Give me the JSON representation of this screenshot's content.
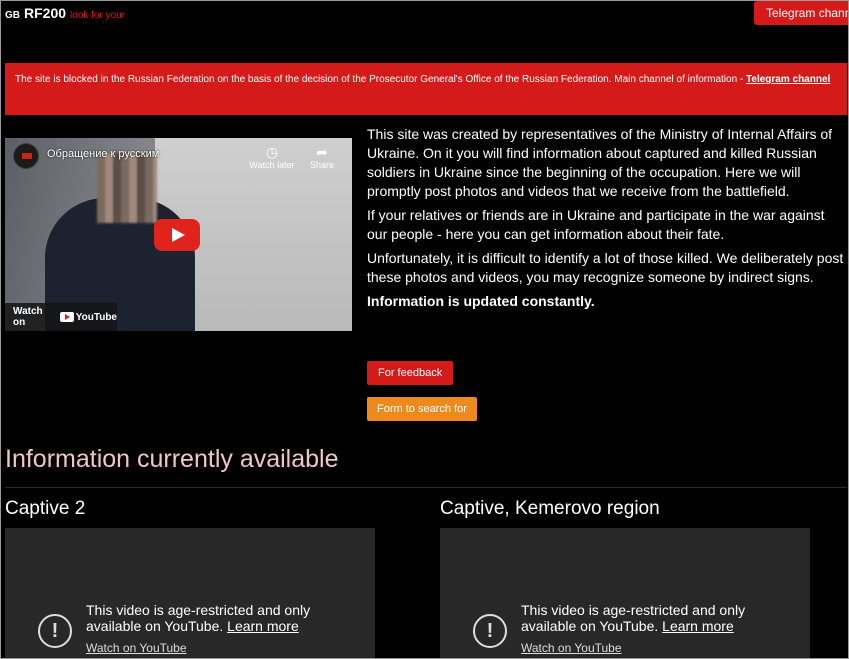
{
  "header": {
    "flag": "GB",
    "brand": "RF200",
    "tagline": "look for your",
    "telegram_button": "Telegram channel"
  },
  "notice": {
    "text": "The site is blocked in the Russian Federation on the basis of the decision of the Prosecutor General's Office of the Russian Federation. Main channel of information - ",
    "link": "Telegram channel"
  },
  "video": {
    "title": "Обращение к русским",
    "watch_later": "Watch later",
    "share": "Share",
    "watch_on": "Watch on",
    "youtube": "YouTube"
  },
  "intro": {
    "p1": "This site was created by representatives of the Ministry of Internal Affairs of Ukraine. On it you will find information about captured and killed Russian soldiers in Ukraine since the beginning of the occupation. Here we will promptly post photos and videos that we receive from the battlefield.",
    "p2": "If your relatives or friends are in Ukraine and participate in the war against our people - here you can get information about their fate.",
    "p3": "Unfortunately, it is difficult to identify a lot of those killed. We deliberately post these photos and videos, you may recognize someone by indirect signs.",
    "p4": "Information is updated constantly."
  },
  "buttons": {
    "feedback": "For feedback",
    "search_form": "Form to search for"
  },
  "section": {
    "title": "Information currently available"
  },
  "cards": [
    {
      "title": "Captive 2",
      "message": "This video is age-restricted and only available on YouTube.",
      "learn_more": "Learn more",
      "watch": "Watch on YouTube"
    },
    {
      "title": "Captive, Kemerovo region",
      "message": "This video is age-restricted and only available on YouTube.",
      "learn_more": "Learn more",
      "watch": "Watch on YouTube"
    }
  ],
  "colors": {
    "accent_red": "#d51a1a",
    "accent_orange": "#ee8a1b",
    "background": "#000000"
  }
}
